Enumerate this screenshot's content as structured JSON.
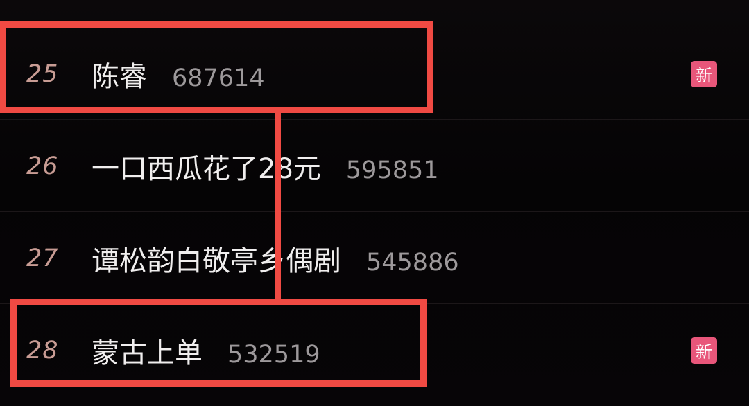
{
  "trending": {
    "items": [
      {
        "rank": "25",
        "title": "陈睿",
        "count": "687614",
        "badge": "新"
      },
      {
        "rank": "26",
        "title": "一口西瓜花了28元",
        "count": "595851",
        "badge": ""
      },
      {
        "rank": "27",
        "title": "谭松韵白敬亭乡偶剧",
        "count": "545886",
        "badge": ""
      },
      {
        "rank": "28",
        "title": "蒙古上单",
        "count": "532519",
        "badge": "新"
      }
    ]
  },
  "colors": {
    "background": "#050405",
    "rank_text": "#c89c94",
    "title_text": "#f0eeee",
    "count_text": "#9d999b",
    "new_badge": "#e8567a",
    "highlight_box": "#f04a43"
  }
}
